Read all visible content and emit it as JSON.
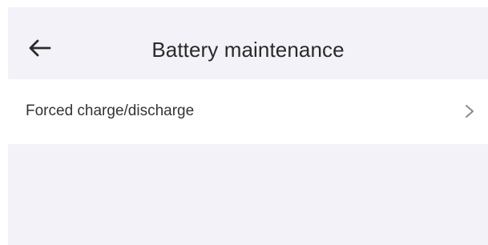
{
  "header": {
    "title": "Battery maintenance",
    "back_icon": "arrow-left-icon"
  },
  "list": {
    "items": [
      {
        "label": "Forced charge/discharge",
        "icon": "chevron-right-icon"
      }
    ]
  },
  "colors": {
    "page_background": "#f3f2f8",
    "card_background": "#ffffff",
    "text_primary": "#2a2a2a",
    "icon_gray": "#8a8a8a"
  }
}
